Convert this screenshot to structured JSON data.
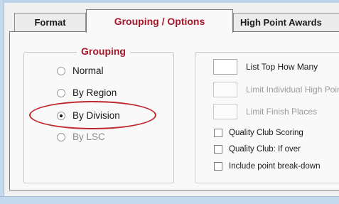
{
  "tabs": {
    "format": "Format",
    "grouping_options": "Grouping / Options",
    "high_point": "High Point Awards"
  },
  "grouping": {
    "legend": "Grouping",
    "options": [
      "Normal",
      "By Region",
      "By Division",
      "By LSC"
    ],
    "selected": "By Division"
  },
  "options": {
    "numeric": [
      {
        "label": "List Top How Many",
        "enabled": true,
        "value": ""
      },
      {
        "label": "Limit Individual High Point",
        "enabled": false,
        "value": ""
      },
      {
        "label": "Limit Finish Places",
        "enabled": false,
        "value": ""
      }
    ],
    "checkboxes": [
      {
        "label": "Quality Club Scoring",
        "checked": false
      },
      {
        "label": "Quality Club: If over",
        "checked": false
      },
      {
        "label": "Include point break-down",
        "checked": false
      }
    ]
  },
  "colors": {
    "accent": "#a8162a",
    "highlight": "#c0272d"
  }
}
